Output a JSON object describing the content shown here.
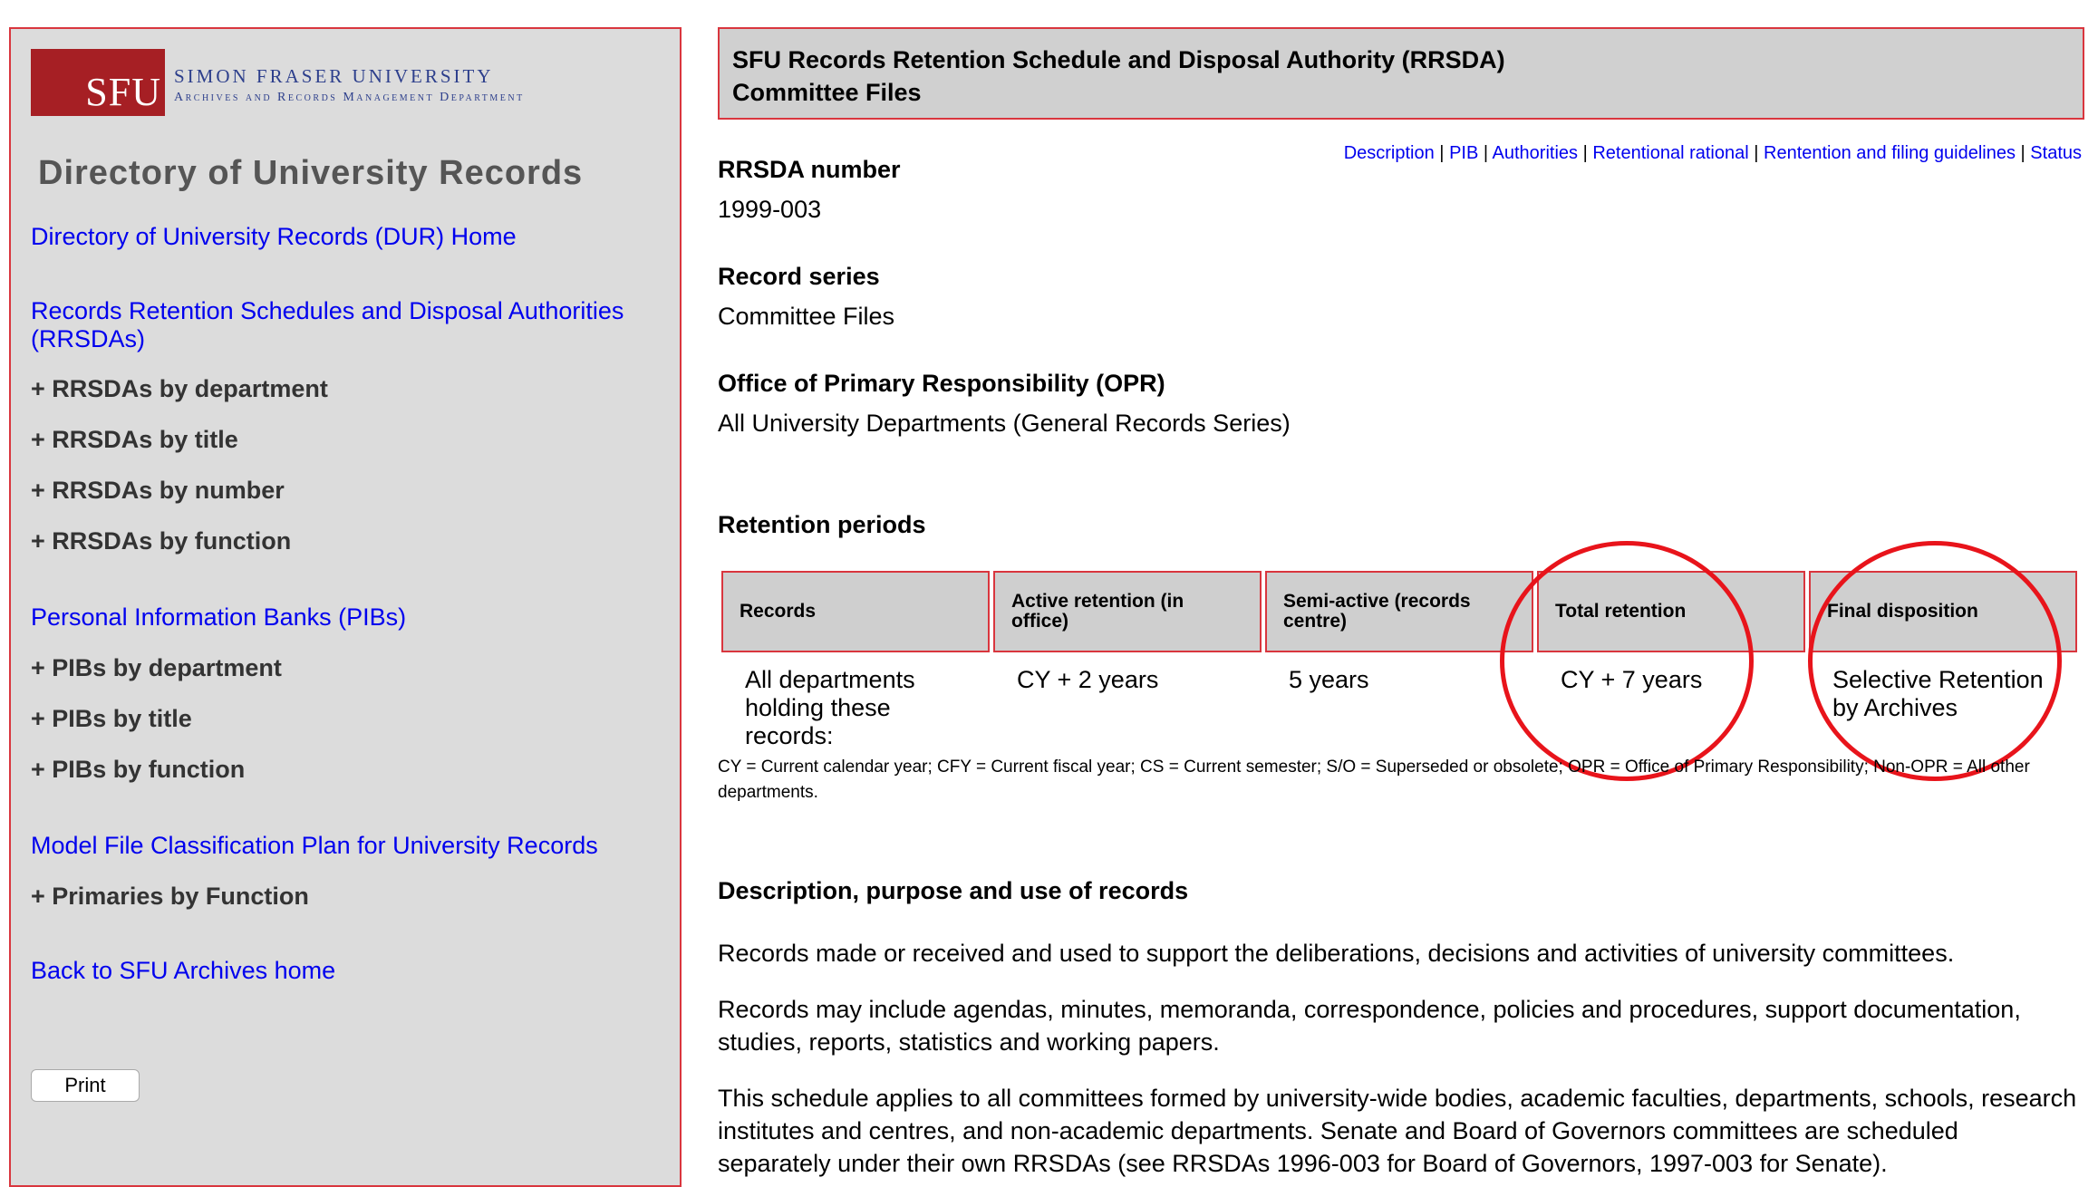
{
  "sidebar": {
    "logo_text": "SFU",
    "university_name": "SIMON FRASER UNIVERSITY",
    "department_name": "Archives and Records Management Department",
    "directory_title": "Directory of University Records",
    "links": {
      "dur_home": "Directory of University Records (DUR) Home",
      "rrsdas": "Records Retention Schedules and Disposal Authorities (RRSDAs)",
      "pibs": "Personal Information Banks (PIBs)",
      "model_plan": "Model File Classification Plan for University Records",
      "archives_home": "Back to SFU Archives home"
    },
    "rrsda_items": [
      "+ RRSDAs by department",
      "+ RRSDAs by title",
      "+ RRSDAs by number",
      "+ RRSDAs by function"
    ],
    "pib_items": [
      "+ PIBs by department",
      "+ PIBs by title",
      "+ PIBs by function"
    ],
    "primaries_item": "+ Primaries by Function",
    "print_label": "Print"
  },
  "header": {
    "line1": "SFU Records Retention Schedule and Disposal Authority (RRSDA)",
    "line2": "Committee Files"
  },
  "toplinks": [
    "Description",
    "PIB",
    "Authorities",
    "Retentional rational",
    "Rentention and filing guidelines",
    "Status"
  ],
  "fields": {
    "rrsda_number_label": "RRSDA number",
    "rrsda_number_value": "1999-003",
    "record_series_label": "Record series",
    "record_series_value": "Committee Files",
    "opr_label": "Office of Primary Responsibility (OPR)",
    "opr_value": "All University Departments (General Records Series)"
  },
  "retention": {
    "heading": "Retention periods",
    "columns": [
      "Records",
      "Active retention (in office)",
      "Semi-active (records centre)",
      "Total retention",
      "Final disposition"
    ],
    "row": [
      "All departments holding these records:",
      "CY + 2 years",
      "5 years",
      "CY + 7 years",
      "Selective Retention by Archives"
    ],
    "legend": "CY = Current calendar year; CFY = Current fiscal year; CS = Current semester; S/O = Superseded or obsolete; OPR = Office of Primary Responsibility; Non-OPR = All other departments.",
    "highlight_color": "#e8141b"
  },
  "description": {
    "heading": "Description, purpose and use of records",
    "paragraphs": [
      "Records made or received and used to support the deliberations, decisions and activities of university committees.",
      "Records may include agendas, minutes, memoranda, correspondence, policies and procedures, support documentation, studies, reports, statistics and working papers.",
      "This schedule applies to all committees formed by university-wide bodies, academic faculties, departments, schools, research institutes and centres, and non-academic departments. Senate and Board of Governors committees are scheduled separately under their own RRSDAs (see RRSDAs 1996-003 for Board of Governors, 1997-003 for Senate)."
    ]
  }
}
